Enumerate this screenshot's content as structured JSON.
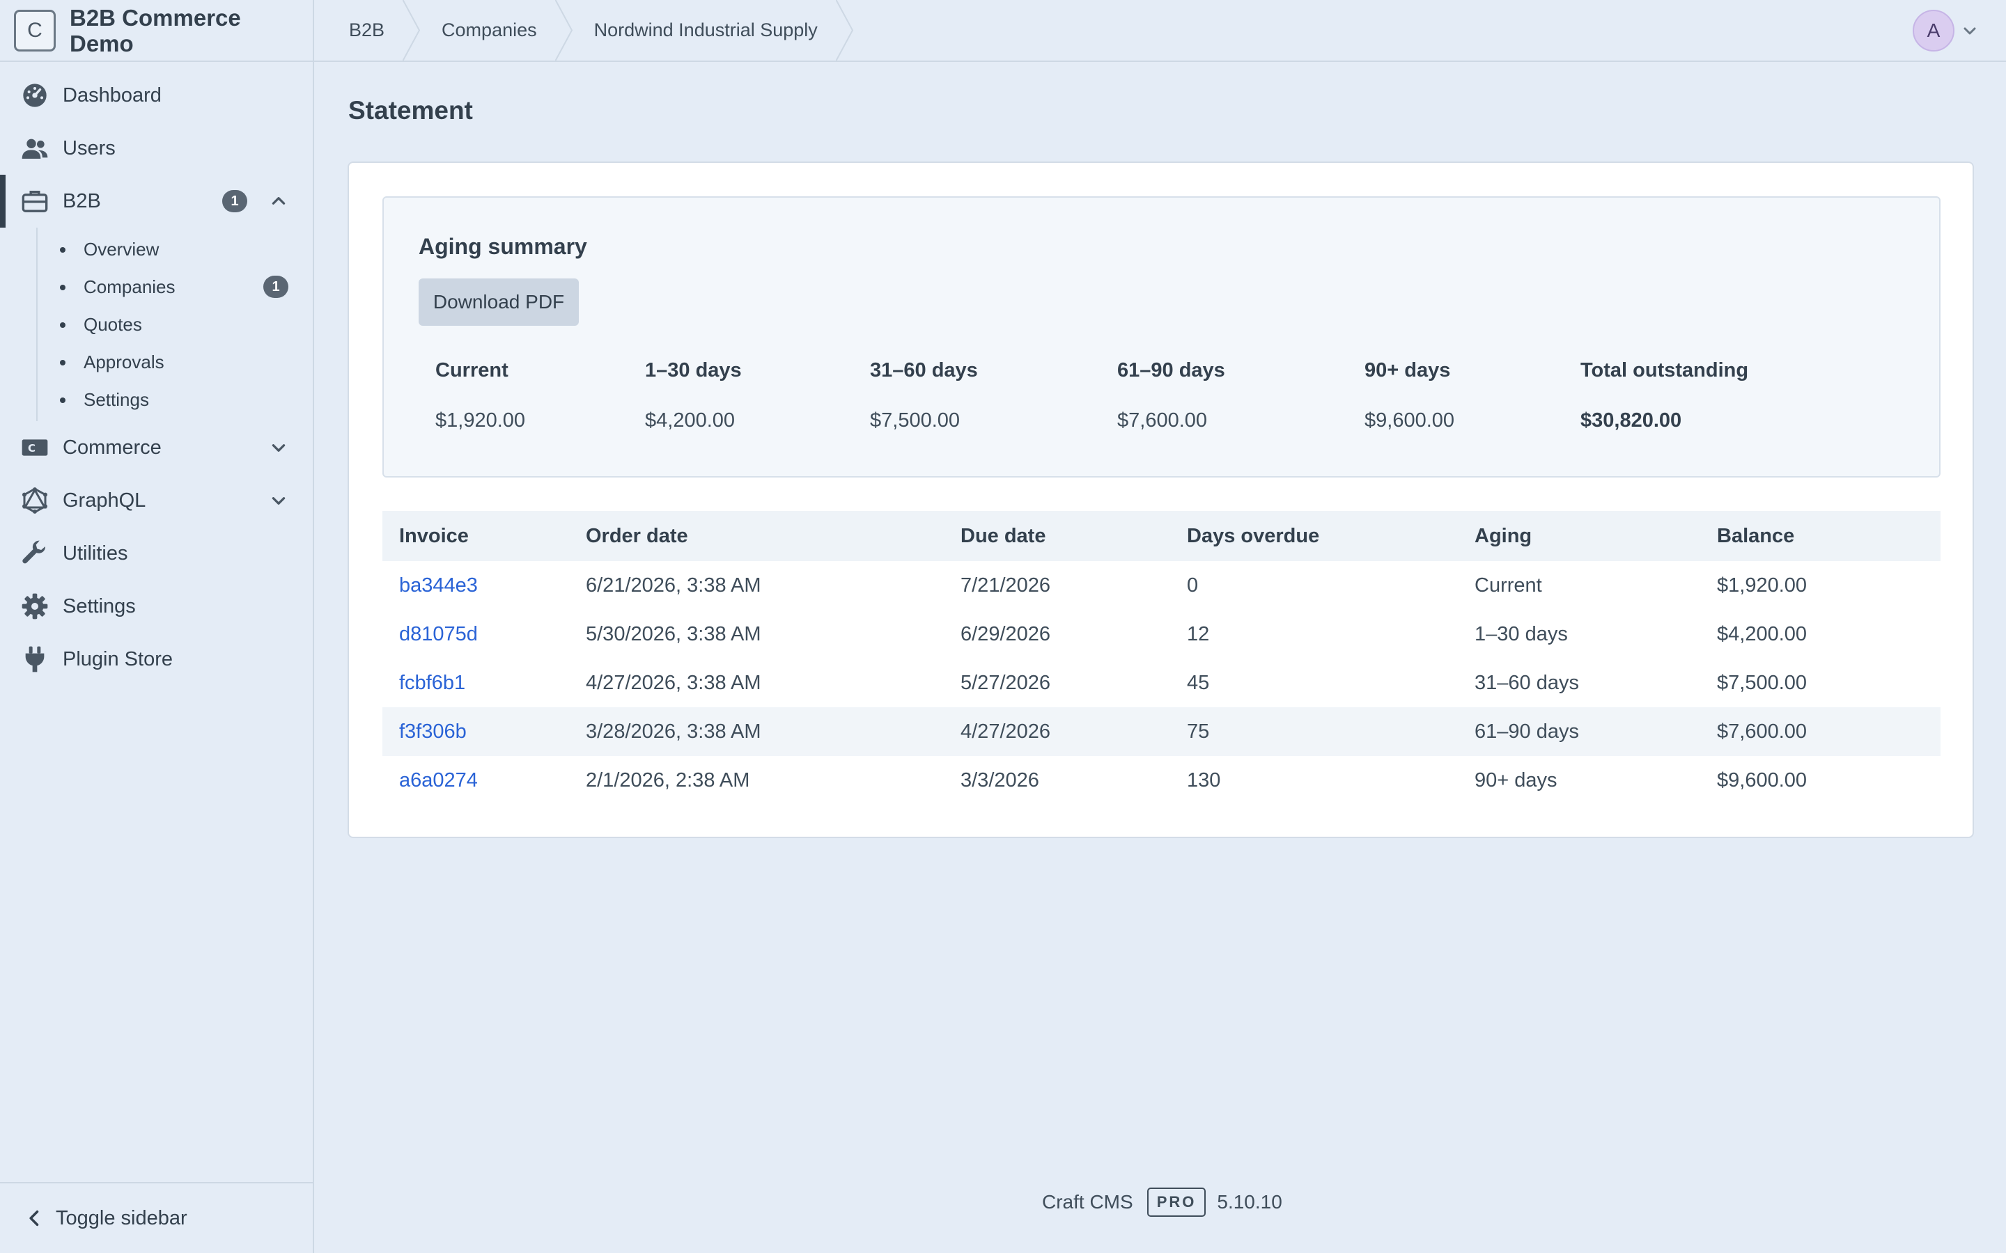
{
  "site": {
    "logo_letter": "C",
    "name": "B2B Commerce Demo"
  },
  "nav": {
    "dashboard": "Dashboard",
    "users": "Users",
    "b2b": {
      "label": "B2B",
      "badge": "1"
    },
    "b2b_sub": {
      "overview": "Overview",
      "companies": {
        "label": "Companies",
        "badge": "1"
      },
      "quotes": "Quotes",
      "approvals": "Approvals",
      "settings": "Settings"
    },
    "commerce": "Commerce",
    "graphql": "GraphQL",
    "utilities": "Utilities",
    "settings": "Settings",
    "plugin_store": "Plugin Store",
    "toggle_sidebar": "Toggle sidebar"
  },
  "breadcrumb": [
    "B2B",
    "Companies",
    "Nordwind Industrial Supply"
  ],
  "account": {
    "initial": "A"
  },
  "page": {
    "title": "Statement"
  },
  "aging": {
    "title": "Aging summary",
    "download_label": "Download PDF",
    "headers": [
      "Current",
      "1–30 days",
      "31–60 days",
      "61–90 days",
      "90+ days",
      "Total outstanding"
    ],
    "values": [
      "$1,920.00",
      "$4,200.00",
      "$7,500.00",
      "$7,600.00",
      "$9,600.00",
      "$30,820.00"
    ]
  },
  "table": {
    "headers": [
      "Invoice",
      "Order date",
      "Due date",
      "Days overdue",
      "Aging",
      "Balance"
    ],
    "rows": [
      [
        "ba344e3",
        "6/21/2026, 3:38 AM",
        "7/21/2026",
        "0",
        "Current",
        "$1,920.00"
      ],
      [
        "d81075d",
        "5/30/2026, 3:38 AM",
        "6/29/2026",
        "12",
        "1–30 days",
        "$4,200.00"
      ],
      [
        "fcbf6b1",
        "4/27/2026, 3:38 AM",
        "5/27/2026",
        "45",
        "31–60 days",
        "$7,500.00"
      ],
      [
        "f3f306b",
        "3/28/2026, 3:38 AM",
        "4/27/2026",
        "75",
        "61–90 days",
        "$7,600.00"
      ],
      [
        "a6a0274",
        "2/1/2026, 2:38 AM",
        "3/3/2026",
        "130",
        "90+ days",
        "$9,600.00"
      ]
    ]
  },
  "footer": {
    "product": "Craft CMS",
    "edition": "PRO",
    "version": "5.10.10"
  }
}
